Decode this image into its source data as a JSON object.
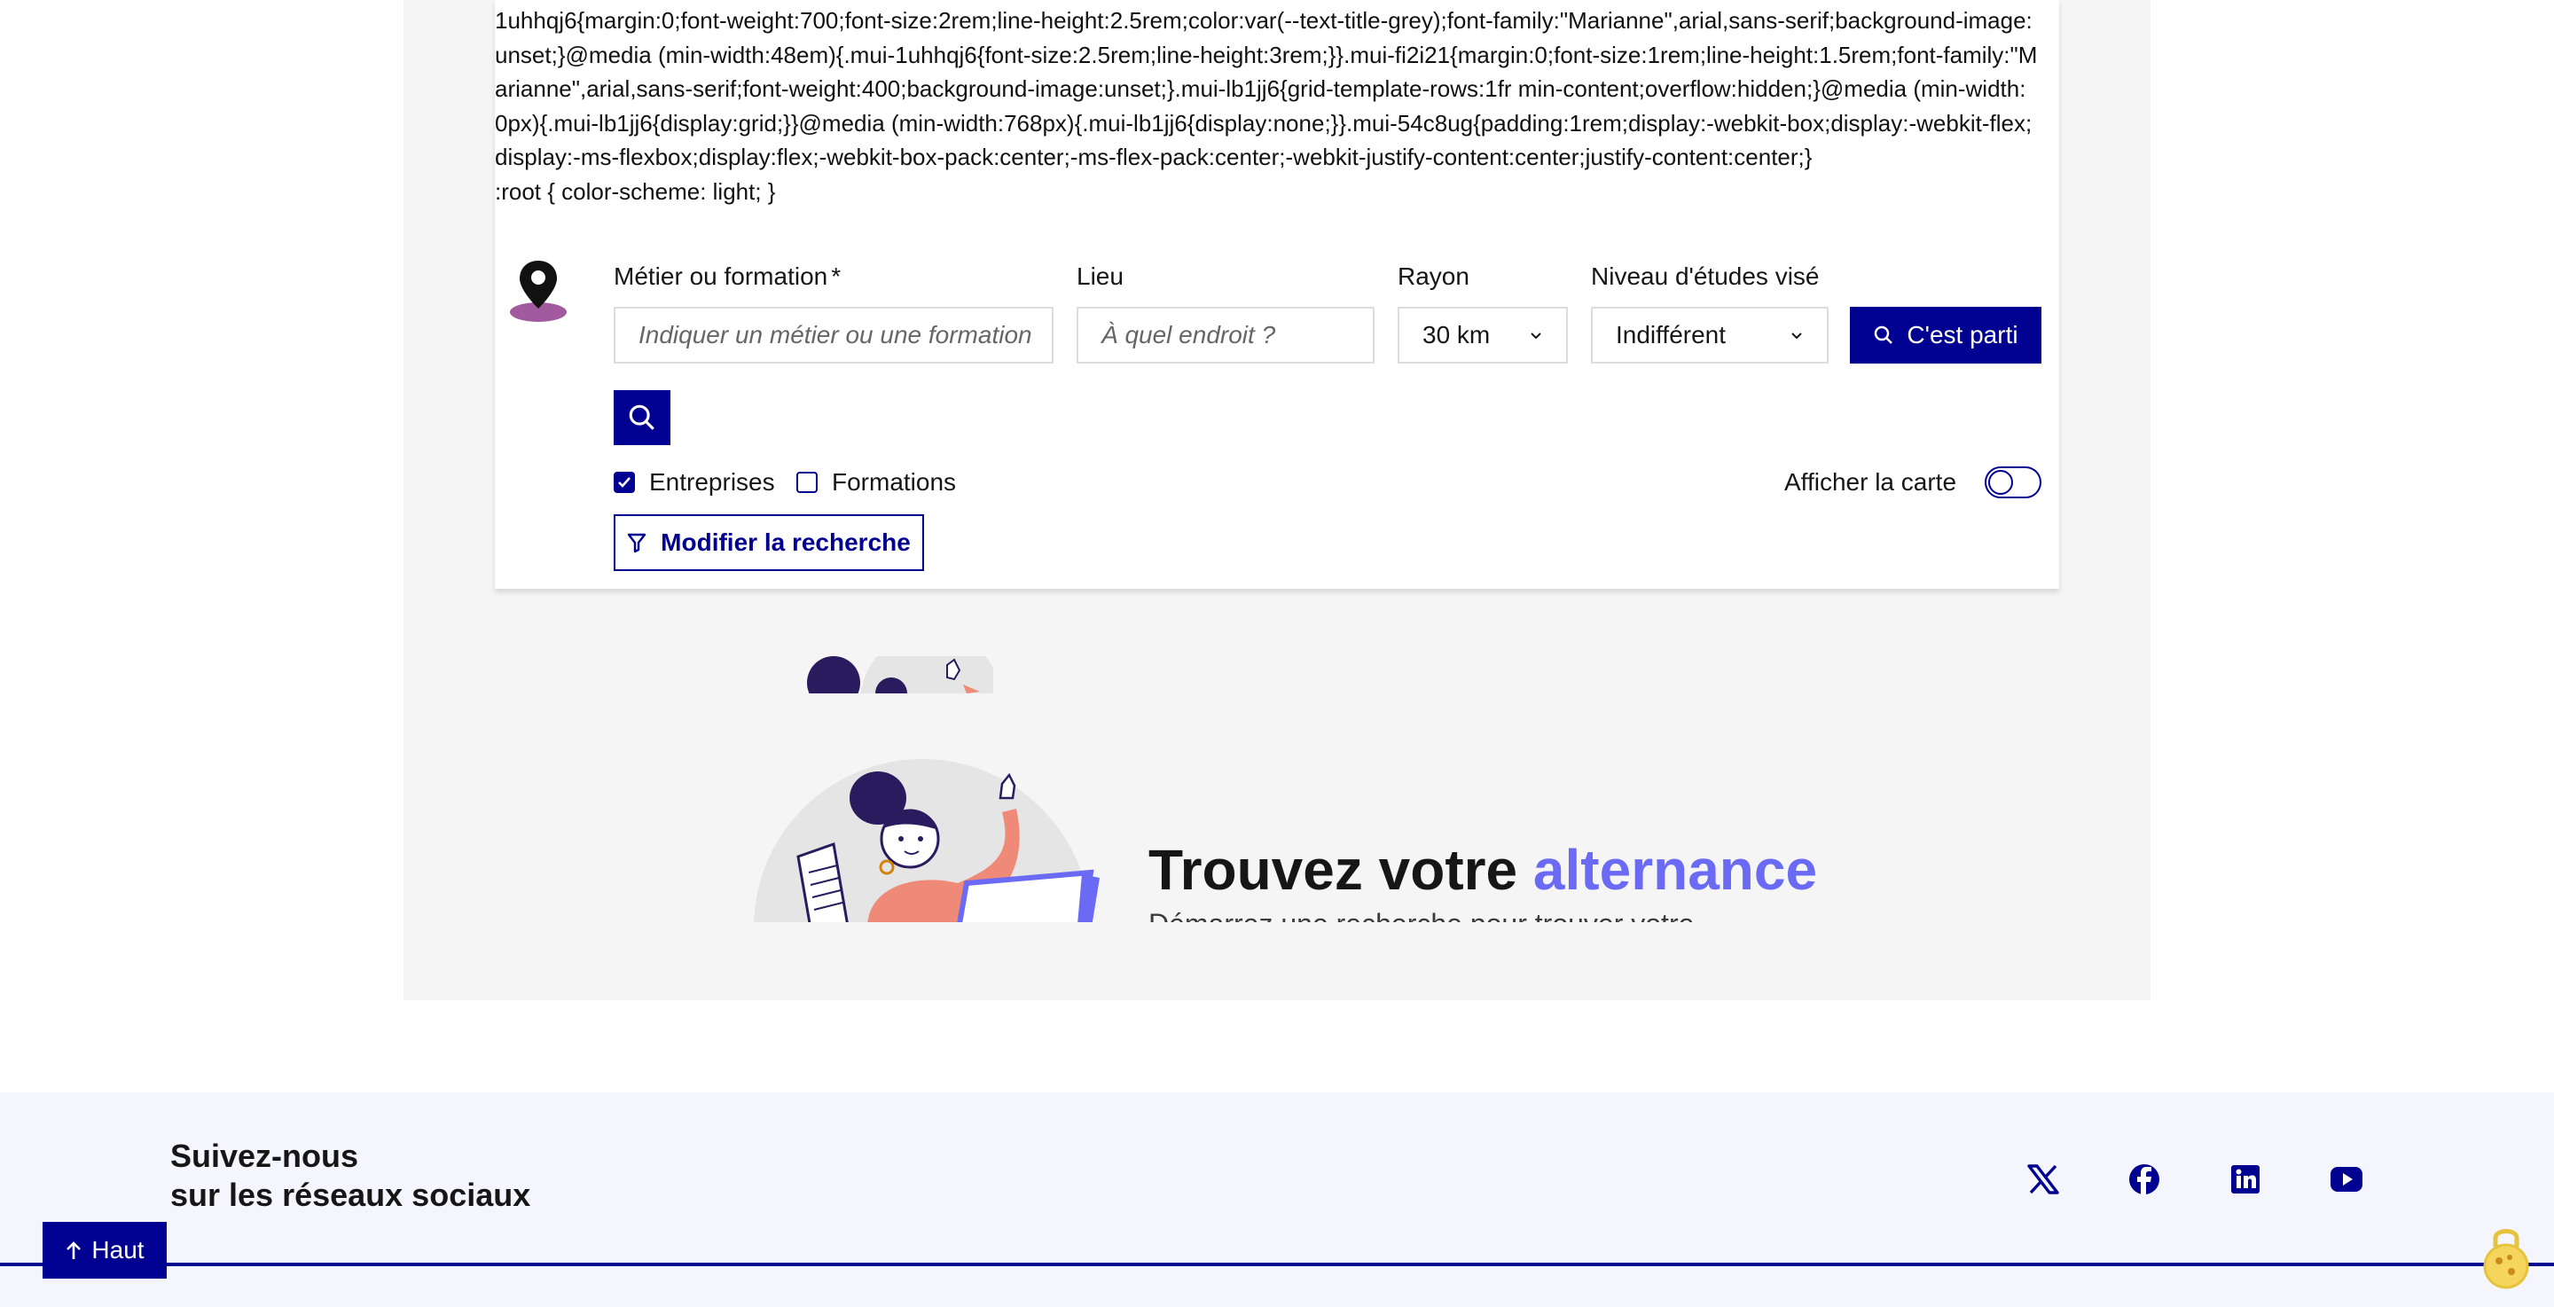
{
  "css_leak_text": "1uhhqj6{margin:0;font-weight:700;font-size:2rem;line-height:2.5rem;color:var(--text-title-grey);font-family:\"Marianne\",arial,sans-serif;background-image:unset;}@media (min-width:48em){.mui-1uhhqj6{font-size:2.5rem;line-height:3rem;}}.mui-fi2i21{margin:0;font-size:1rem;line-height:1.5rem;font-family:\"Marianne\",arial,sans-serif;font-weight:400;background-image:unset;}.mui-lb1jj6{grid-template-rows:1fr min-content;overflow:hidden;}@media (min-width:0px){.mui-lb1jj6{display:grid;}}@media (min-width:768px){.mui-lb1jj6{display:none;}}.mui-54c8ug{padding:1rem;display:-webkit-box;display:-webkit-flex;display:-ms-flexbox;display:flex;-webkit-box-pack:center;-ms-flex-pack:center;-webkit-justify-content:center;justify-content:center;}\n:root { color-scheme: light; }",
  "search": {
    "metier_label": "Métier ou formation",
    "metier_required": "*",
    "metier_placeholder": "Indiquer un métier ou une formation",
    "lieu_label": "Lieu",
    "lieu_placeholder": "À quel endroit ?",
    "rayon_label": "Rayon",
    "rayon_value": "30 km",
    "niveau_label": "Niveau d'études visé",
    "niveau_value": "Indifférent",
    "submit_label": "C'est parti"
  },
  "filters": {
    "entreprises_label": "Entreprises",
    "entreprises_checked": true,
    "formations_label": "Formations",
    "formations_checked": false,
    "map_toggle_label": "Afficher la carte",
    "map_toggle_on": false,
    "modify_label": "Modifier la recherche"
  },
  "hero": {
    "title_part1": "Trouvez votre ",
    "title_accent": "alternance",
    "subtitle": "Démarrez une recherche pour trouver votre"
  },
  "footer": {
    "follow_line1": "Suivez-nous",
    "follow_line2": "sur les réseaux sociaux",
    "social_icons": [
      "x-icon",
      "facebook-icon",
      "linkedin-icon",
      "youtube-icon"
    ]
  },
  "back_to_top_label": "Haut",
  "colors": {
    "primary_blue": "#000091",
    "accent_purple": "#6a6af4",
    "page_bg": "#f5f5f5",
    "footer_bg": "#f5f5fe"
  }
}
